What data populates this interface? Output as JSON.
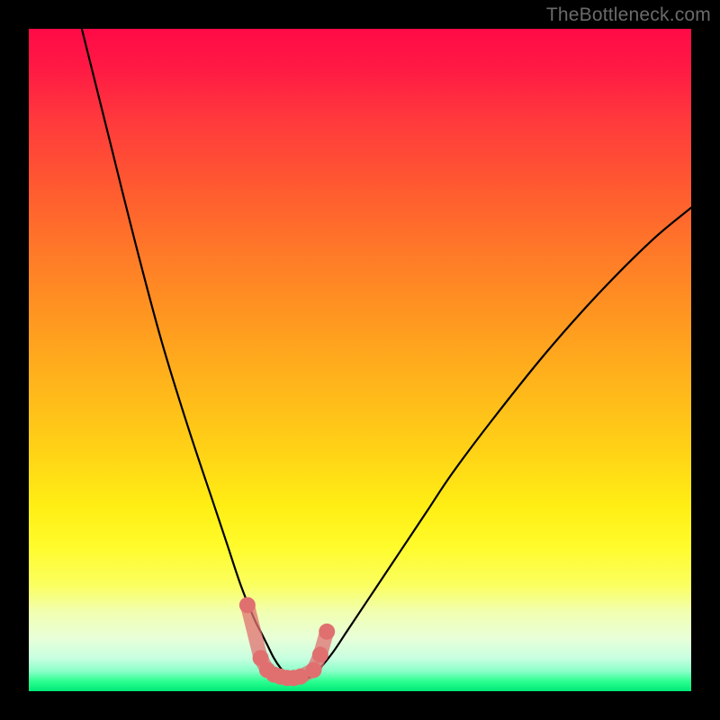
{
  "watermark": "TheBottleneck.com",
  "colors": {
    "background": "#000000",
    "curve_stroke": "#000000",
    "marker_fill": "#e07070",
    "gradient_top": "#ff0a47",
    "gradient_bottom": "#00e878"
  },
  "chart_data": {
    "type": "line",
    "title": "",
    "xlabel": "",
    "ylabel": "",
    "xlim": [
      0,
      100
    ],
    "ylim": [
      0,
      100
    ],
    "grid": false,
    "legend": false,
    "series": [
      {
        "name": "bottleneck-curve",
        "x": [
          8,
          12,
          16,
          20,
          24,
          28,
          30,
          32,
          34,
          35,
          36,
          37,
          38,
          39,
          40,
          41,
          42,
          43,
          44,
          46,
          48,
          52,
          56,
          60,
          64,
          70,
          78,
          86,
          94,
          100
        ],
        "values": [
          100,
          84,
          68,
          53,
          40,
          28,
          22,
          16,
          11,
          9,
          7,
          5,
          3.5,
          2.5,
          2,
          2,
          2,
          2.5,
          3.5,
          6,
          9,
          15,
          21,
          27,
          33,
          41,
          51,
          60,
          68,
          73
        ]
      },
      {
        "name": "markers",
        "x": [
          33,
          35,
          36,
          37,
          38,
          39,
          40,
          41,
          43,
          44,
          45
        ],
        "values": [
          13,
          5,
          3.2,
          2.5,
          2.2,
          2.0,
          2.0,
          2.2,
          3.2,
          5.5,
          9
        ]
      }
    ],
    "annotations": []
  }
}
